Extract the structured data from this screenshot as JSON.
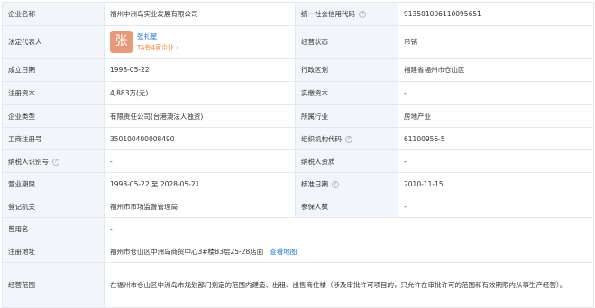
{
  "rows": {
    "company_name": {
      "label": "企业名称",
      "value": "福州中洲岛实业发展有限公司"
    },
    "credit_code": {
      "label": "统一社会信用代码",
      "value": "913501006110095651"
    },
    "legal_rep": {
      "label": "法定代表人",
      "avatar_char": "张",
      "name": "张礼星",
      "sub": "TA有4家企业 ›"
    },
    "status": {
      "label": "经营状态",
      "value": "吊销"
    },
    "founded": {
      "label": "成立日期",
      "value": "1998-05-22"
    },
    "district": {
      "label": "行政区划",
      "value": "福建省福州市仓山区"
    },
    "reg_capital": {
      "label": "注册资本",
      "value": "4,883万(元)"
    },
    "paid_capital": {
      "label": "实缴资本",
      "value": "-"
    },
    "company_type": {
      "label": "企业类型",
      "value": "有限责任公司(台港澳法人独资)"
    },
    "industry": {
      "label": "所属行业",
      "value": "房地产业"
    },
    "biz_reg_no": {
      "label": "工商注册号",
      "value": "350100400008490"
    },
    "org_code": {
      "label": "组织机构代码",
      "value": "61100956-5"
    },
    "taxpayer_id": {
      "label": "纳税人识别号",
      "value": "-"
    },
    "taxpayer_qual": {
      "label": "纳税人资质",
      "value": "-"
    },
    "biz_term": {
      "label": "营业期限",
      "value": "1998-05-22 至 2028-05-21"
    },
    "approval_date": {
      "label": "核准日期",
      "value": "2010-11-15"
    },
    "reg_authority": {
      "label": "登记机关",
      "value": "福州市市场监督管理局"
    },
    "insured": {
      "label": "参保人数",
      "value": "-"
    },
    "former_name": {
      "label": "曾用名",
      "value": "-"
    },
    "reg_address": {
      "label": "注册地址",
      "value": "福州市仓山区中洲岛商贸中心3#楼B3层25-28店面",
      "link": "查看地图"
    },
    "biz_scope": {
      "label": "经营范围",
      "value": "在福州市仓山区中洲岛市规划部门划定的范围内建造、出租、出售商住楼（涉及审批许可项目的，只允许在审批许可的范围和有效期限内从事生产经营）。"
    }
  },
  "colors": {
    "label_bg": "#f2f6fb",
    "border": "#e4e9f0",
    "link": "#1e6fd9",
    "avatar_bg": "#e69a7a",
    "accent_orange": "#f2883a"
  },
  "icons": {
    "help": "question-circle-icon"
  }
}
